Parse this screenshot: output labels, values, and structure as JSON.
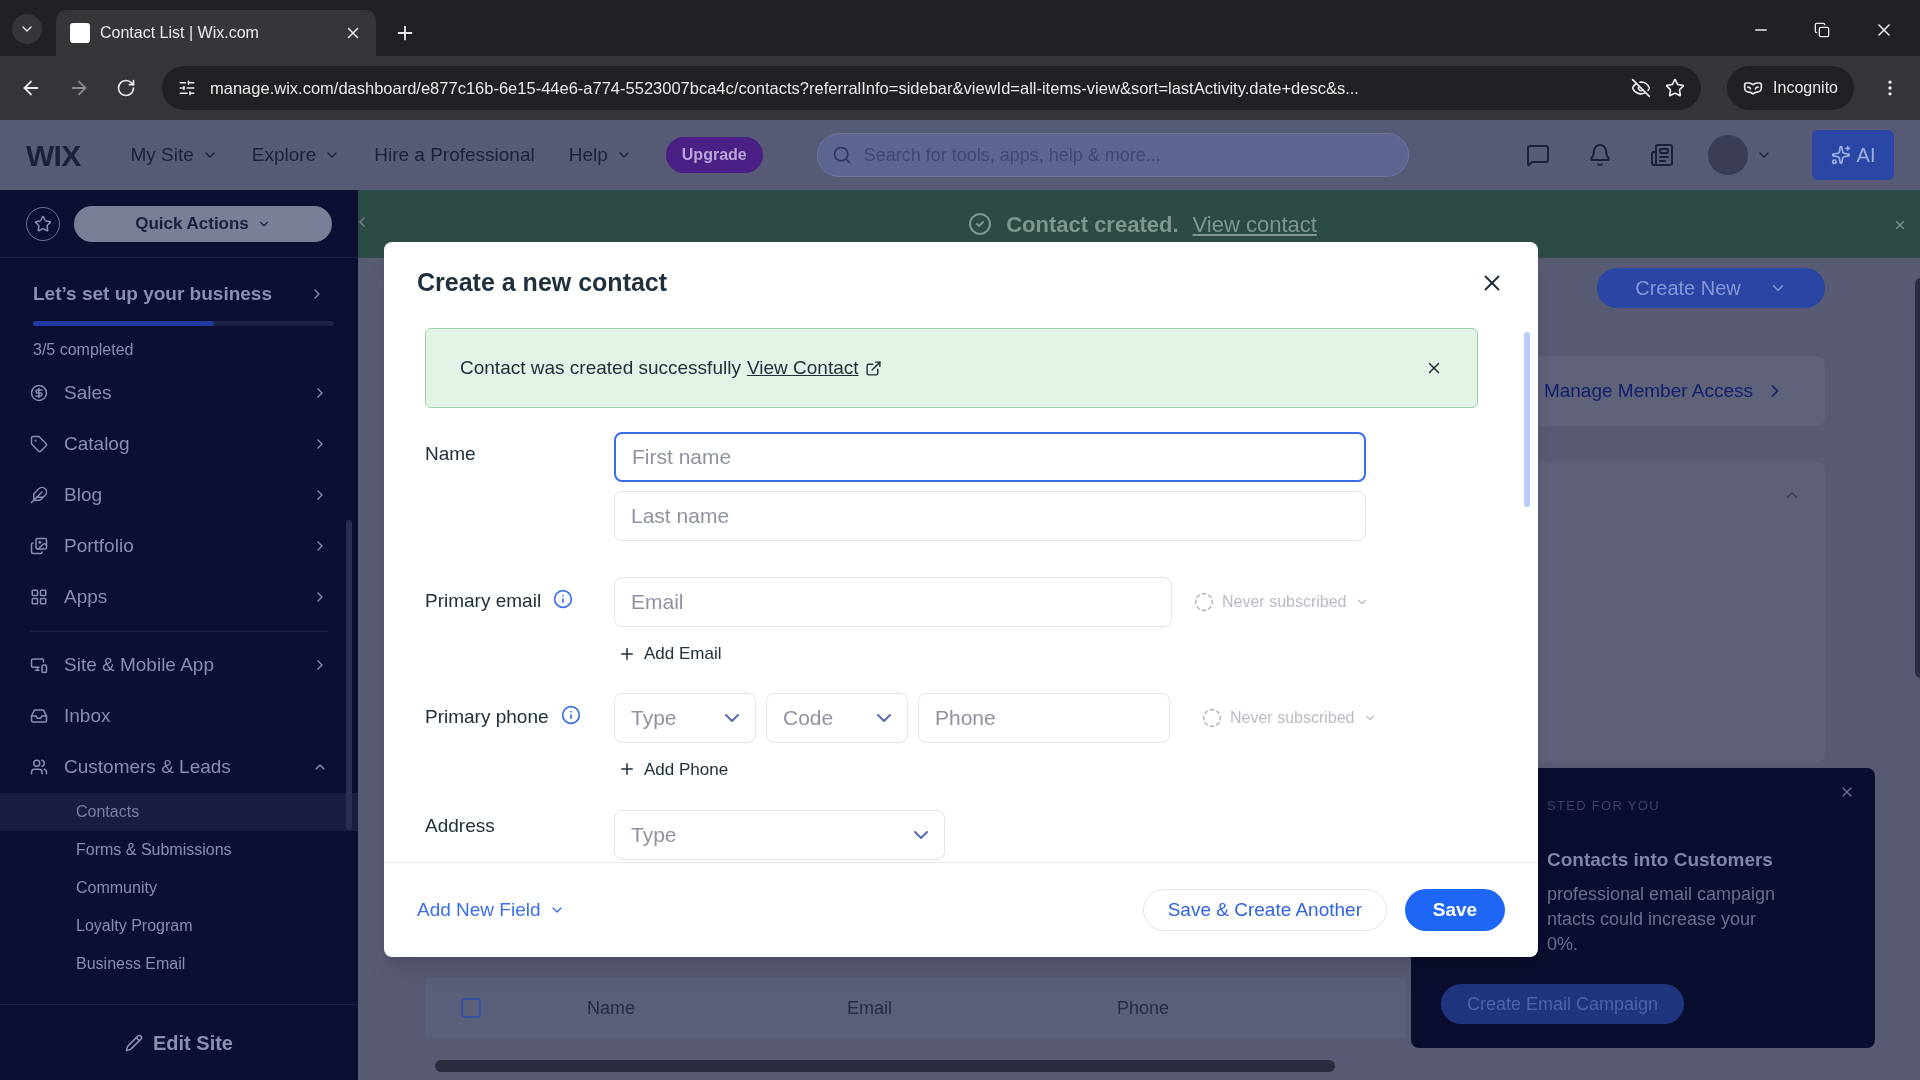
{
  "browser": {
    "tabs": [
      {
        "title": "Contact List | Wix.com",
        "selected": true
      }
    ],
    "url": "manage.wix.com/dashboard/e877c16b-6e15-44e6-a774-5523007bca4c/contacts?referralInfo=sidebar&viewId=all-items-view&sort=lastActivity.date+desc&s...",
    "profile": "Incognito"
  },
  "header": {
    "logo": "WIX",
    "nav": [
      {
        "label": "My Site",
        "dropdown": true
      },
      {
        "label": "Explore",
        "dropdown": true
      },
      {
        "label": "Hire a Professional",
        "dropdown": false
      },
      {
        "label": "Help",
        "dropdown": true
      }
    ],
    "upgrade": "Upgrade",
    "search": {
      "placeholder": "Search for tools, apps, help & more..."
    },
    "ai": "AI"
  },
  "toast": {
    "text": "Contact created.",
    "link": "View contact"
  },
  "sidebar": {
    "quick_actions": "Quick Actions",
    "setup": {
      "title": "Let’s set up your business",
      "level": 0.6,
      "progress": "3/5 completed"
    },
    "items": [
      {
        "label": "Sales",
        "chevron": true,
        "expanded": false
      },
      {
        "label": "Catalog",
        "chevron": true,
        "expanded": false
      },
      {
        "label": "Blog",
        "chevron": true,
        "expanded": false
      },
      {
        "label": "Portfolio",
        "chevron": true,
        "expanded": false
      },
      {
        "label": "Apps",
        "chevron": true,
        "expanded": false
      },
      {
        "label": "Site & Mobile App",
        "chevron": true,
        "expanded": false
      },
      {
        "label": "Inbox",
        "chevron": false,
        "expanded": false
      },
      {
        "label": "Customers & Leads",
        "expanded": true,
        "children": [
          {
            "label": "Contacts",
            "selected": true
          },
          {
            "label": "Forms & Submissions",
            "selected": false
          },
          {
            "label": "Community",
            "selected": false
          },
          {
            "label": "Loyalty Program",
            "selected": false
          },
          {
            "label": "Business Email",
            "selected": false
          }
        ]
      }
    ],
    "edit_site": "Edit Site"
  },
  "background": {
    "select_all": {
      "checked": false
    },
    "create_new": "Create New",
    "manage_access": "Manage Member Access",
    "table_columns": [
      "Name",
      "Email",
      "Phone"
    ],
    "promo": {
      "eyebrow": "STED FOR YOU",
      "title": "Contacts into Customers",
      "lines": [
        "professional email campaign",
        "ntacts could increase your",
        "0%."
      ],
      "button": "Create Email Campaign"
    }
  },
  "modal": {
    "title": "Create a new contact",
    "alert": {
      "text": "Contact was created successfully",
      "link": "View Contact"
    },
    "name": {
      "label": "Name",
      "inputs": [
        {
          "placeholder": "First name",
          "focused": true
        },
        {
          "placeholder": "Last name",
          "focused": false
        }
      ]
    },
    "email": {
      "label": "Primary email",
      "placeholder": "Email",
      "subscription": "Never subscribed",
      "add": "Add Email"
    },
    "phone": {
      "label": "Primary phone",
      "type": "Type",
      "code": "Code",
      "placeholder": "Phone",
      "subscription": "Never subscribed",
      "add": "Add Phone"
    },
    "address": {
      "label": "Address",
      "type": "Type"
    },
    "footer": {
      "add_field": "Add New Field",
      "secondary": "Save & Create Another",
      "primary": "Save"
    }
  }
}
